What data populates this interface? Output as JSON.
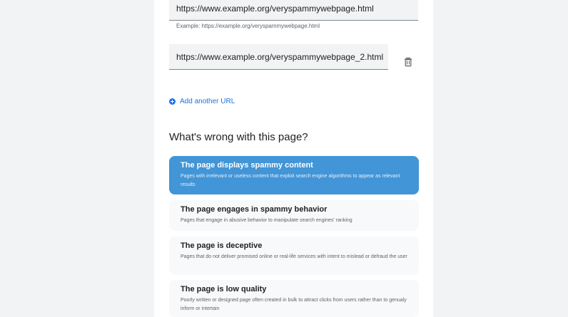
{
  "urls": [
    {
      "value": "https://www.example.org/veryspammywebpage.html"
    },
    {
      "value": "https://www.example.org/veryspammywebpage_2.html"
    }
  ],
  "helper_text": "Example: https://example.org/veryspammywebpage.html",
  "add_url_label": "Add another URL",
  "question": "What's wrong with this page?",
  "options": [
    {
      "title": "The page displays spammy content",
      "desc": "Pages with irrelevant or useless content that exploit search engine algorithms to appear as relevant results",
      "selected": true
    },
    {
      "title": "The page engages in spammy behavior",
      "desc": "Pages that engage in abusive behavior to manipulate search engines' ranking",
      "selected": false
    },
    {
      "title": "The page is deceptive",
      "desc": "Pages that do not deliver promised online or real-life services with intent to mislead or defraud the user",
      "selected": false
    },
    {
      "title": "The page is low quality",
      "desc": "Poorly written or designed page often created in bulk to attract clicks from users rather than to genualy inform or intertain",
      "selected": false
    }
  ],
  "colors": {
    "accent": "#1a73e8",
    "selected_bg": "#4295d6",
    "field_bg": "#f1f3f4"
  }
}
